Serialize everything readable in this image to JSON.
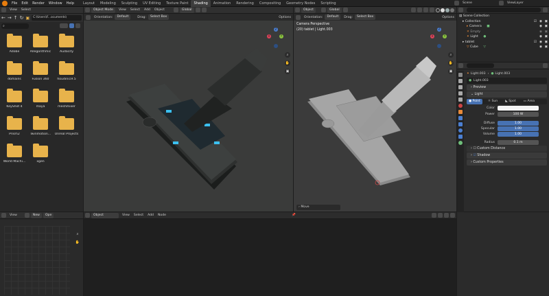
{
  "topbar": {
    "menus": [
      "File",
      "Edit",
      "Render",
      "Window",
      "Help"
    ],
    "workspaces": [
      "Layout",
      "Modeling",
      "Sculpting",
      "UV Editing",
      "Texture Paint",
      "Shading",
      "Animation",
      "Rendering",
      "Compositing",
      "Geometry Nodes",
      "Scripting"
    ],
    "active_workspace": "Shading",
    "scene": "Scene",
    "view_layer": "ViewLayer"
  },
  "file_browser": {
    "menus": [
      "View",
      "Select"
    ],
    "path": "C:\\Users\\F...ocuments\\",
    "folders": [
      "Adobe",
      "Allegorithmic",
      "Audacity",
      "domains",
      "Fusion 360",
      "houdini19.5",
      "KeyShot 4",
      "maya",
      "meshmixer",
      "Prism2",
      "Twinmotion...",
      "Unreal Projects",
      "World Machi...",
      "xgen"
    ]
  },
  "viewport_left": {
    "mode": "Object Mode",
    "menus": [
      "View",
      "Select",
      "Add",
      "Object"
    ],
    "transform": "Global",
    "orientation_label": "Orientation:",
    "orientation": "Default",
    "drag_label": "Drag:",
    "drag": "Select Box",
    "options": "Options"
  },
  "viewport_right": {
    "mode": "Object",
    "transform": "Global",
    "orientation_label": "Orientation:",
    "orientation": "Default",
    "drag_label": "Drag:",
    "drag": "Select Box",
    "options": "Options",
    "camera_label": "Camera Perspective",
    "object_info": "(20) tablet | Light.003",
    "last_op": "Move"
  },
  "gizmo": {
    "x": "X",
    "y": "Y",
    "z": "Z"
  },
  "outliner": {
    "title": "Scene Collection",
    "rows": [
      {
        "label": "Collection",
        "indent": 1
      },
      {
        "label": "Camera",
        "indent": 2
      },
      {
        "label": "Empty",
        "indent": 2
      },
      {
        "label": "Light",
        "indent": 2
      },
      {
        "label": "tablet",
        "indent": 1
      },
      {
        "label": "Cube",
        "indent": 2
      }
    ]
  },
  "properties": {
    "breadcrumb_obj": "Light.003",
    "breadcrumb_data": "Light.003",
    "data_name": "Light.003",
    "panels": {
      "preview": "Preview",
      "light": "Light",
      "custom_distance": "Custom Distance",
      "shadow": "Shadow",
      "custom_props": "Custom Properties"
    },
    "light_types": [
      "Point",
      "Sun",
      "Spot",
      "Area"
    ],
    "active_light_type": "Point",
    "fields": [
      {
        "label": "Color",
        "value": "",
        "kind": "color"
      },
      {
        "label": "Power",
        "value": "100 W",
        "kind": "plain"
      },
      {
        "label": "Diffuse",
        "value": "1.00",
        "kind": "blue"
      },
      {
        "label": "Specular",
        "value": "1.00",
        "kind": "blue"
      },
      {
        "label": "Volume",
        "value": "1.00",
        "kind": "blue"
      },
      {
        "label": "Radius",
        "value": "0.1 m",
        "kind": "plain"
      }
    ]
  },
  "node_editor": {
    "object": "Object",
    "menus": [
      "View",
      "Select",
      "Add",
      "Node"
    ]
  },
  "small_editor": {
    "view": "View",
    "new": "New",
    "open": "Ope"
  },
  "colors": {
    "accent_blue": "#4772b3",
    "folder": "#e8b34b",
    "x_axis": "#e0435a",
    "y_axis": "#8bc43f",
    "z_axis": "#4b7fd1"
  }
}
